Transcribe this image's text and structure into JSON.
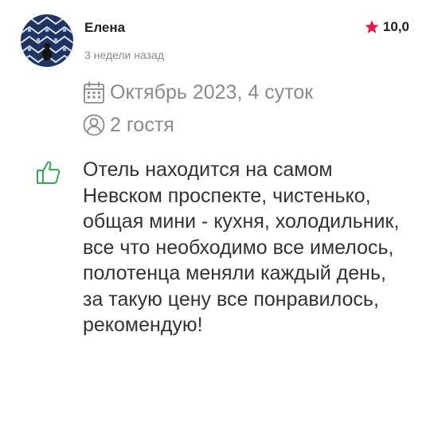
{
  "review": {
    "author": "Елена",
    "date": "3 недели назад",
    "rating": "10,0",
    "stay": "Октябрь 2023, 4 суток",
    "guests": "2 гостя",
    "text": "Отель находится на самом Невском проспекте, чистенько, общая мини - кухня, холодильник, все что необходимо все имелось, полотенца меняли каждый день, за такую цену все понравилось, рекомендую!"
  },
  "icons": {
    "rating": "star-icon",
    "stay": "calendar-icon",
    "guests": "guests-icon",
    "sentiment": "thumbs-up-icon"
  },
  "colors": {
    "star": "#e8184c",
    "thumb": "#34a853",
    "muted": "#8a8a8a",
    "text": "#333333"
  }
}
